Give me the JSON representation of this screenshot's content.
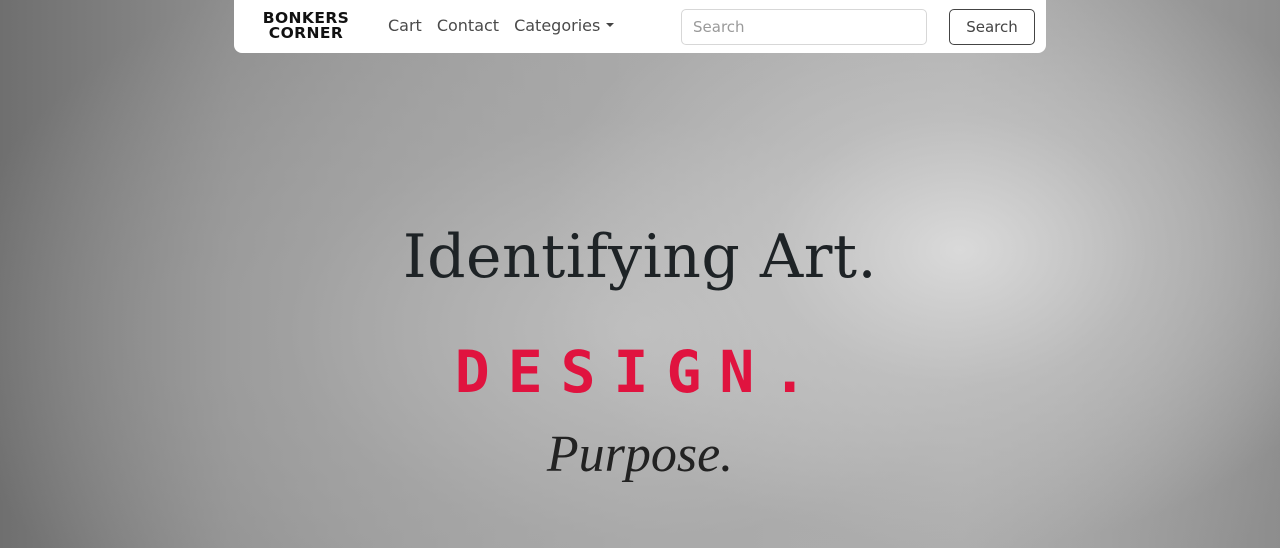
{
  "navbar": {
    "brand_line1": "BONKERS",
    "brand_line2": "CORNER",
    "links": [
      {
        "label": "Cart"
      },
      {
        "label": "Contact"
      },
      {
        "label": "Categories"
      }
    ],
    "search_placeholder": "Search",
    "search_value": "",
    "search_button_label": "Search"
  },
  "hero": {
    "line1": "Identifying Art.",
    "line2": "DESIGN.",
    "line3": "Purpose."
  },
  "colors": {
    "accent": "#e0133f",
    "text_dark": "#1e2326",
    "navbar_bg": "#ffffff"
  }
}
